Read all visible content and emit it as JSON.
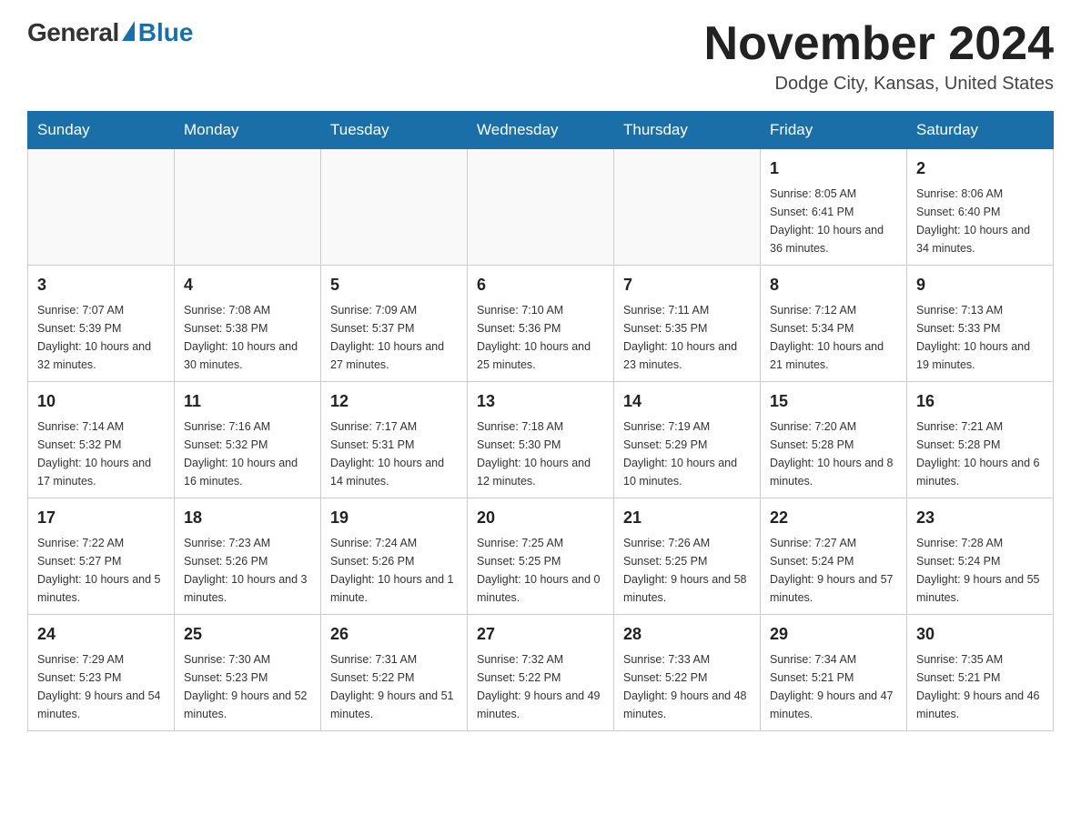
{
  "header": {
    "logo_general": "General",
    "logo_blue": "Blue",
    "month_title": "November 2024",
    "location": "Dodge City, Kansas, United States"
  },
  "weekdays": [
    "Sunday",
    "Monday",
    "Tuesday",
    "Wednesday",
    "Thursday",
    "Friday",
    "Saturday"
  ],
  "weeks": [
    [
      {
        "day": "",
        "info": ""
      },
      {
        "day": "",
        "info": ""
      },
      {
        "day": "",
        "info": ""
      },
      {
        "day": "",
        "info": ""
      },
      {
        "day": "",
        "info": ""
      },
      {
        "day": "1",
        "info": "Sunrise: 8:05 AM\nSunset: 6:41 PM\nDaylight: 10 hours and 36 minutes."
      },
      {
        "day": "2",
        "info": "Sunrise: 8:06 AM\nSunset: 6:40 PM\nDaylight: 10 hours and 34 minutes."
      }
    ],
    [
      {
        "day": "3",
        "info": "Sunrise: 7:07 AM\nSunset: 5:39 PM\nDaylight: 10 hours and 32 minutes."
      },
      {
        "day": "4",
        "info": "Sunrise: 7:08 AM\nSunset: 5:38 PM\nDaylight: 10 hours and 30 minutes."
      },
      {
        "day": "5",
        "info": "Sunrise: 7:09 AM\nSunset: 5:37 PM\nDaylight: 10 hours and 27 minutes."
      },
      {
        "day": "6",
        "info": "Sunrise: 7:10 AM\nSunset: 5:36 PM\nDaylight: 10 hours and 25 minutes."
      },
      {
        "day": "7",
        "info": "Sunrise: 7:11 AM\nSunset: 5:35 PM\nDaylight: 10 hours and 23 minutes."
      },
      {
        "day": "8",
        "info": "Sunrise: 7:12 AM\nSunset: 5:34 PM\nDaylight: 10 hours and 21 minutes."
      },
      {
        "day": "9",
        "info": "Sunrise: 7:13 AM\nSunset: 5:33 PM\nDaylight: 10 hours and 19 minutes."
      }
    ],
    [
      {
        "day": "10",
        "info": "Sunrise: 7:14 AM\nSunset: 5:32 PM\nDaylight: 10 hours and 17 minutes."
      },
      {
        "day": "11",
        "info": "Sunrise: 7:16 AM\nSunset: 5:32 PM\nDaylight: 10 hours and 16 minutes."
      },
      {
        "day": "12",
        "info": "Sunrise: 7:17 AM\nSunset: 5:31 PM\nDaylight: 10 hours and 14 minutes."
      },
      {
        "day": "13",
        "info": "Sunrise: 7:18 AM\nSunset: 5:30 PM\nDaylight: 10 hours and 12 minutes."
      },
      {
        "day": "14",
        "info": "Sunrise: 7:19 AM\nSunset: 5:29 PM\nDaylight: 10 hours and 10 minutes."
      },
      {
        "day": "15",
        "info": "Sunrise: 7:20 AM\nSunset: 5:28 PM\nDaylight: 10 hours and 8 minutes."
      },
      {
        "day": "16",
        "info": "Sunrise: 7:21 AM\nSunset: 5:28 PM\nDaylight: 10 hours and 6 minutes."
      }
    ],
    [
      {
        "day": "17",
        "info": "Sunrise: 7:22 AM\nSunset: 5:27 PM\nDaylight: 10 hours and 5 minutes."
      },
      {
        "day": "18",
        "info": "Sunrise: 7:23 AM\nSunset: 5:26 PM\nDaylight: 10 hours and 3 minutes."
      },
      {
        "day": "19",
        "info": "Sunrise: 7:24 AM\nSunset: 5:26 PM\nDaylight: 10 hours and 1 minute."
      },
      {
        "day": "20",
        "info": "Sunrise: 7:25 AM\nSunset: 5:25 PM\nDaylight: 10 hours and 0 minutes."
      },
      {
        "day": "21",
        "info": "Sunrise: 7:26 AM\nSunset: 5:25 PM\nDaylight: 9 hours and 58 minutes."
      },
      {
        "day": "22",
        "info": "Sunrise: 7:27 AM\nSunset: 5:24 PM\nDaylight: 9 hours and 57 minutes."
      },
      {
        "day": "23",
        "info": "Sunrise: 7:28 AM\nSunset: 5:24 PM\nDaylight: 9 hours and 55 minutes."
      }
    ],
    [
      {
        "day": "24",
        "info": "Sunrise: 7:29 AM\nSunset: 5:23 PM\nDaylight: 9 hours and 54 minutes."
      },
      {
        "day": "25",
        "info": "Sunrise: 7:30 AM\nSunset: 5:23 PM\nDaylight: 9 hours and 52 minutes."
      },
      {
        "day": "26",
        "info": "Sunrise: 7:31 AM\nSunset: 5:22 PM\nDaylight: 9 hours and 51 minutes."
      },
      {
        "day": "27",
        "info": "Sunrise: 7:32 AM\nSunset: 5:22 PM\nDaylight: 9 hours and 49 minutes."
      },
      {
        "day": "28",
        "info": "Sunrise: 7:33 AM\nSunset: 5:22 PM\nDaylight: 9 hours and 48 minutes."
      },
      {
        "day": "29",
        "info": "Sunrise: 7:34 AM\nSunset: 5:21 PM\nDaylight: 9 hours and 47 minutes."
      },
      {
        "day": "30",
        "info": "Sunrise: 7:35 AM\nSunset: 5:21 PM\nDaylight: 9 hours and 46 minutes."
      }
    ]
  ]
}
